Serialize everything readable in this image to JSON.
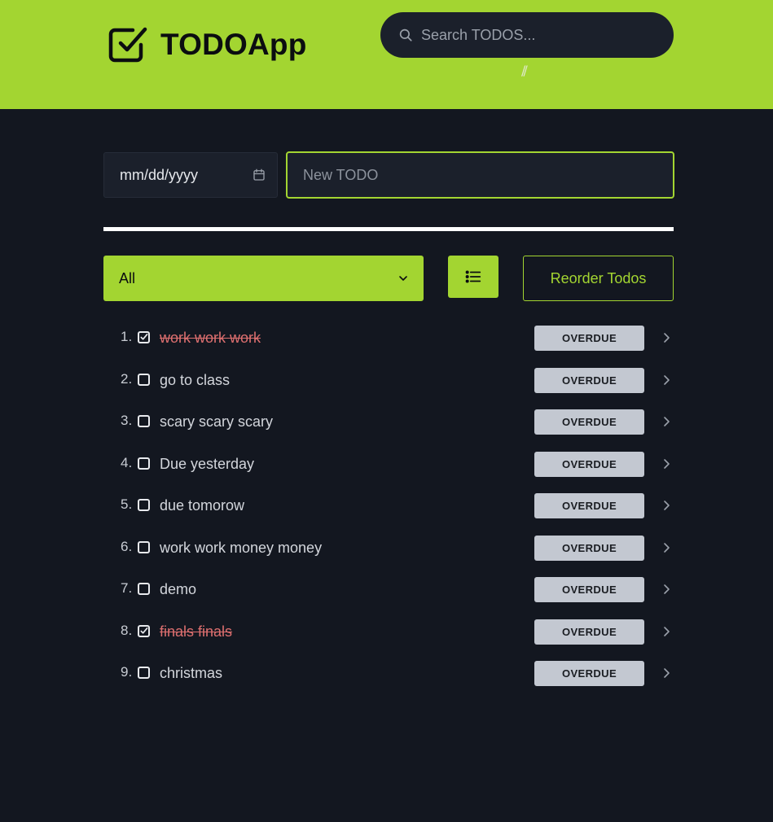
{
  "header": {
    "app_name": "TODOApp",
    "logo_icon": "checkbox-check-icon",
    "search_placeholder": "Search TODOS...",
    "grip_text": "//",
    "brand_color": "#a3d531"
  },
  "form": {
    "date_placeholder": "mm/dd/yyyy",
    "new_todo_placeholder": "New TODO"
  },
  "controls": {
    "filter_value": "All",
    "reorder_label": "Reorder Todos",
    "list_icon": "list-icon"
  },
  "todos": [
    {
      "num": "1.",
      "text": "work work work",
      "done": true,
      "badge": "OVERDUE"
    },
    {
      "num": "2.",
      "text": "go to class",
      "done": false,
      "badge": "OVERDUE"
    },
    {
      "num": "3.",
      "text": "scary scary scary",
      "done": false,
      "badge": "OVERDUE"
    },
    {
      "num": "4.",
      "text": "Due yesterday",
      "done": false,
      "badge": "OVERDUE"
    },
    {
      "num": "5.",
      "text": "due tomorow",
      "done": false,
      "badge": "OVERDUE"
    },
    {
      "num": "6.",
      "text": "work work money money",
      "done": false,
      "badge": "OVERDUE"
    },
    {
      "num": "7.",
      "text": "demo",
      "done": false,
      "badge": "OVERDUE"
    },
    {
      "num": "8.",
      "text": "finals finals",
      "done": true,
      "badge": "OVERDUE"
    },
    {
      "num": "9.",
      "text": "christmas",
      "done": false,
      "badge": "OVERDUE"
    }
  ]
}
